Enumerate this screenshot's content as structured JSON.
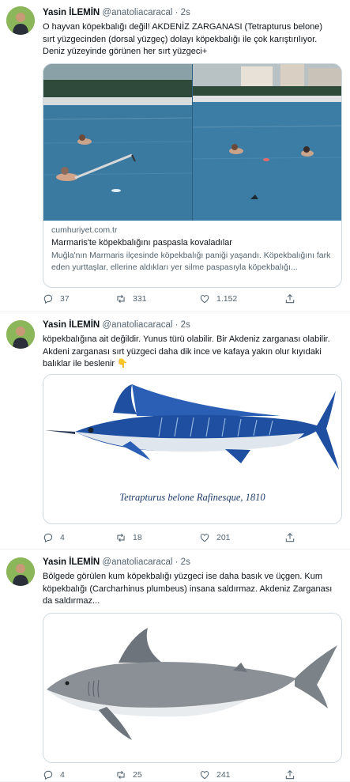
{
  "tweets": [
    {
      "author": "Yasin İLEMİN",
      "handle": "@anatoliacaracal",
      "time": "· 2s",
      "text": "O hayvan köpekbalığı değil! AKDENİZ ZARGANASI (Tetrapturus belone) sırt yüzgecinden (dorsal yüzgeç) dolayı köpekbalığı ile çok karıştırılıyor. Deniz yüzeyinde görünen her sırt yüzgeci+",
      "card": {
        "domain": "cumhuriyet.com.tr",
        "title": "Marmaris'te köpekbalığını paspasla kovaladılar",
        "description": "Muğla'nın Marmaris ilçesinde köpekbalığı paniği yaşandı. Köpekbalığını fark eden yurttaşlar, ellerine aldıkları yer silme paspasıyla köpekbalığı..."
      },
      "stats": {
        "replies": "37",
        "retweets": "331",
        "likes": "1.152"
      }
    },
    {
      "author": "Yasin İLEMİN",
      "handle": "@anatoliacaracal",
      "time": "· 2s",
      "text": "köpekbalığına ait değildir. Yunus türü olabilir. Bir Akdeniz zarganası olabilir. Akdeni zarganası sırt yüzgeci daha dik ince ve kafaya yakın olur kıyıdaki balıklar ile beslenir 👇",
      "caption": "Tetrapturus belone Rafinesque, 1810",
      "stats": {
        "replies": "4",
        "retweets": "18",
        "likes": "201"
      }
    },
    {
      "author": "Yasin İLEMİN",
      "handle": "@anatoliacaracal",
      "time": "· 2s",
      "text": "Bölgede görülen kum köpekbalığı yüzgeci ise daha basık ve üçgen. Kum köpekbalığı (Carcharhinus plumbeus) insana saldırmaz. Akdeniz Zarganası da saldırmaz...",
      "stats": {
        "replies": "4",
        "retweets": "25",
        "likes": "241"
      }
    }
  ],
  "icons": [
    "reply-icon",
    "retweet-icon",
    "like-icon",
    "share-icon"
  ],
  "colors": {
    "text": "#0f1419",
    "secondary": "#536471",
    "border": "#cfd9de",
    "marlin_blue": "#1f4fa0"
  }
}
